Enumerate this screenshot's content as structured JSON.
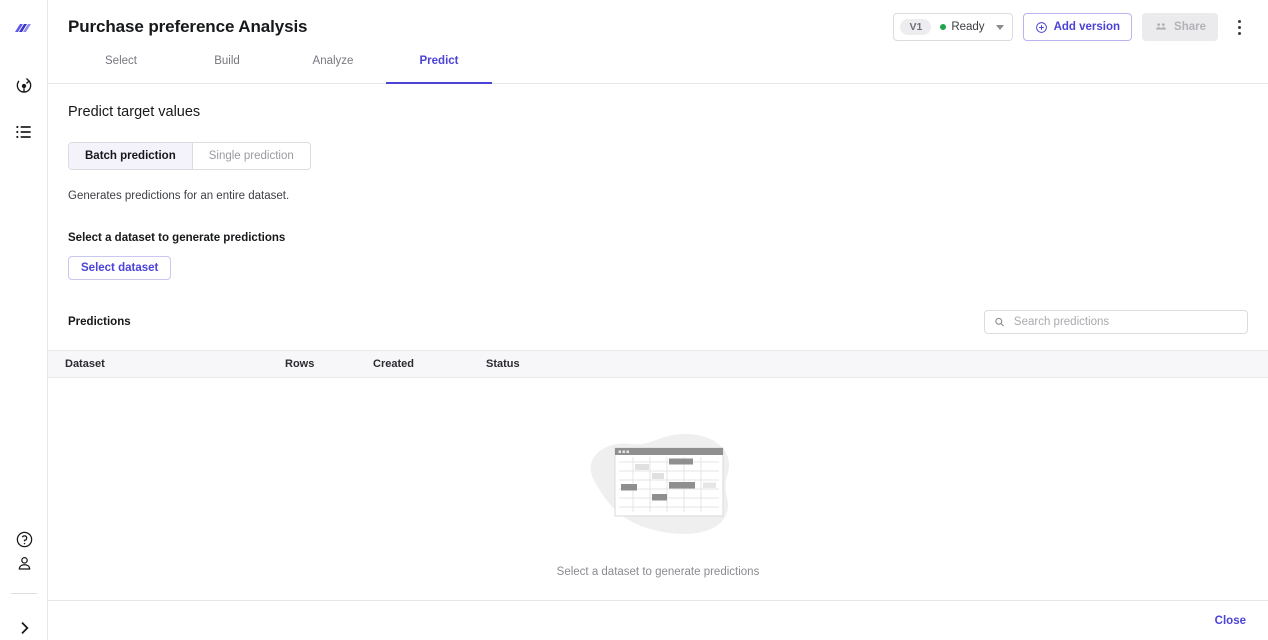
{
  "sidebar": {
    "logo_icon": "app-logo-icon",
    "items": [
      {
        "icon": "model-compass-icon",
        "name": "models"
      },
      {
        "icon": "list-icon",
        "name": "datasets"
      }
    ],
    "bottom_items": [
      {
        "icon": "help-circle-icon",
        "name": "help"
      },
      {
        "icon": "user-icon",
        "name": "account"
      },
      {
        "icon": "chevron-right-icon",
        "name": "expand-sidebar"
      }
    ]
  },
  "header": {
    "title": "Purchase preference Analysis",
    "version_label": "V1",
    "status_label": "Ready",
    "status_color": "#21a44b",
    "add_version_label": "Add version",
    "share_label": "Share",
    "more_menu": "more-options"
  },
  "tabs": [
    {
      "label": "Select",
      "active": false
    },
    {
      "label": "Build",
      "active": false
    },
    {
      "label": "Analyze",
      "active": false
    },
    {
      "label": "Predict",
      "active": true
    }
  ],
  "main": {
    "section_title": "Predict target values",
    "segmented": {
      "batch_label": "Batch prediction",
      "single_label": "Single prediction",
      "selected": "Batch prediction"
    },
    "helper_text": "Generates predictions for an entire dataset.",
    "dataset_label": "Select a dataset to generate predictions",
    "select_dataset_button": "Select dataset",
    "predictions_title": "Predictions",
    "search": {
      "placeholder": "Search predictions",
      "value": "",
      "icon": "search-icon"
    },
    "table": {
      "columns": [
        "Dataset",
        "Rows",
        "Created",
        "Status"
      ],
      "rows": [],
      "empty_caption": "Select a dataset to generate predictions"
    }
  },
  "footer": {
    "close_label": "Close"
  },
  "colors": {
    "accent": "#4b43d6",
    "accent_soft": "#f4f3fb",
    "border": "#e6e6e8",
    "header_bg": "#f7f7f9",
    "muted_text": "#8a8b90"
  }
}
